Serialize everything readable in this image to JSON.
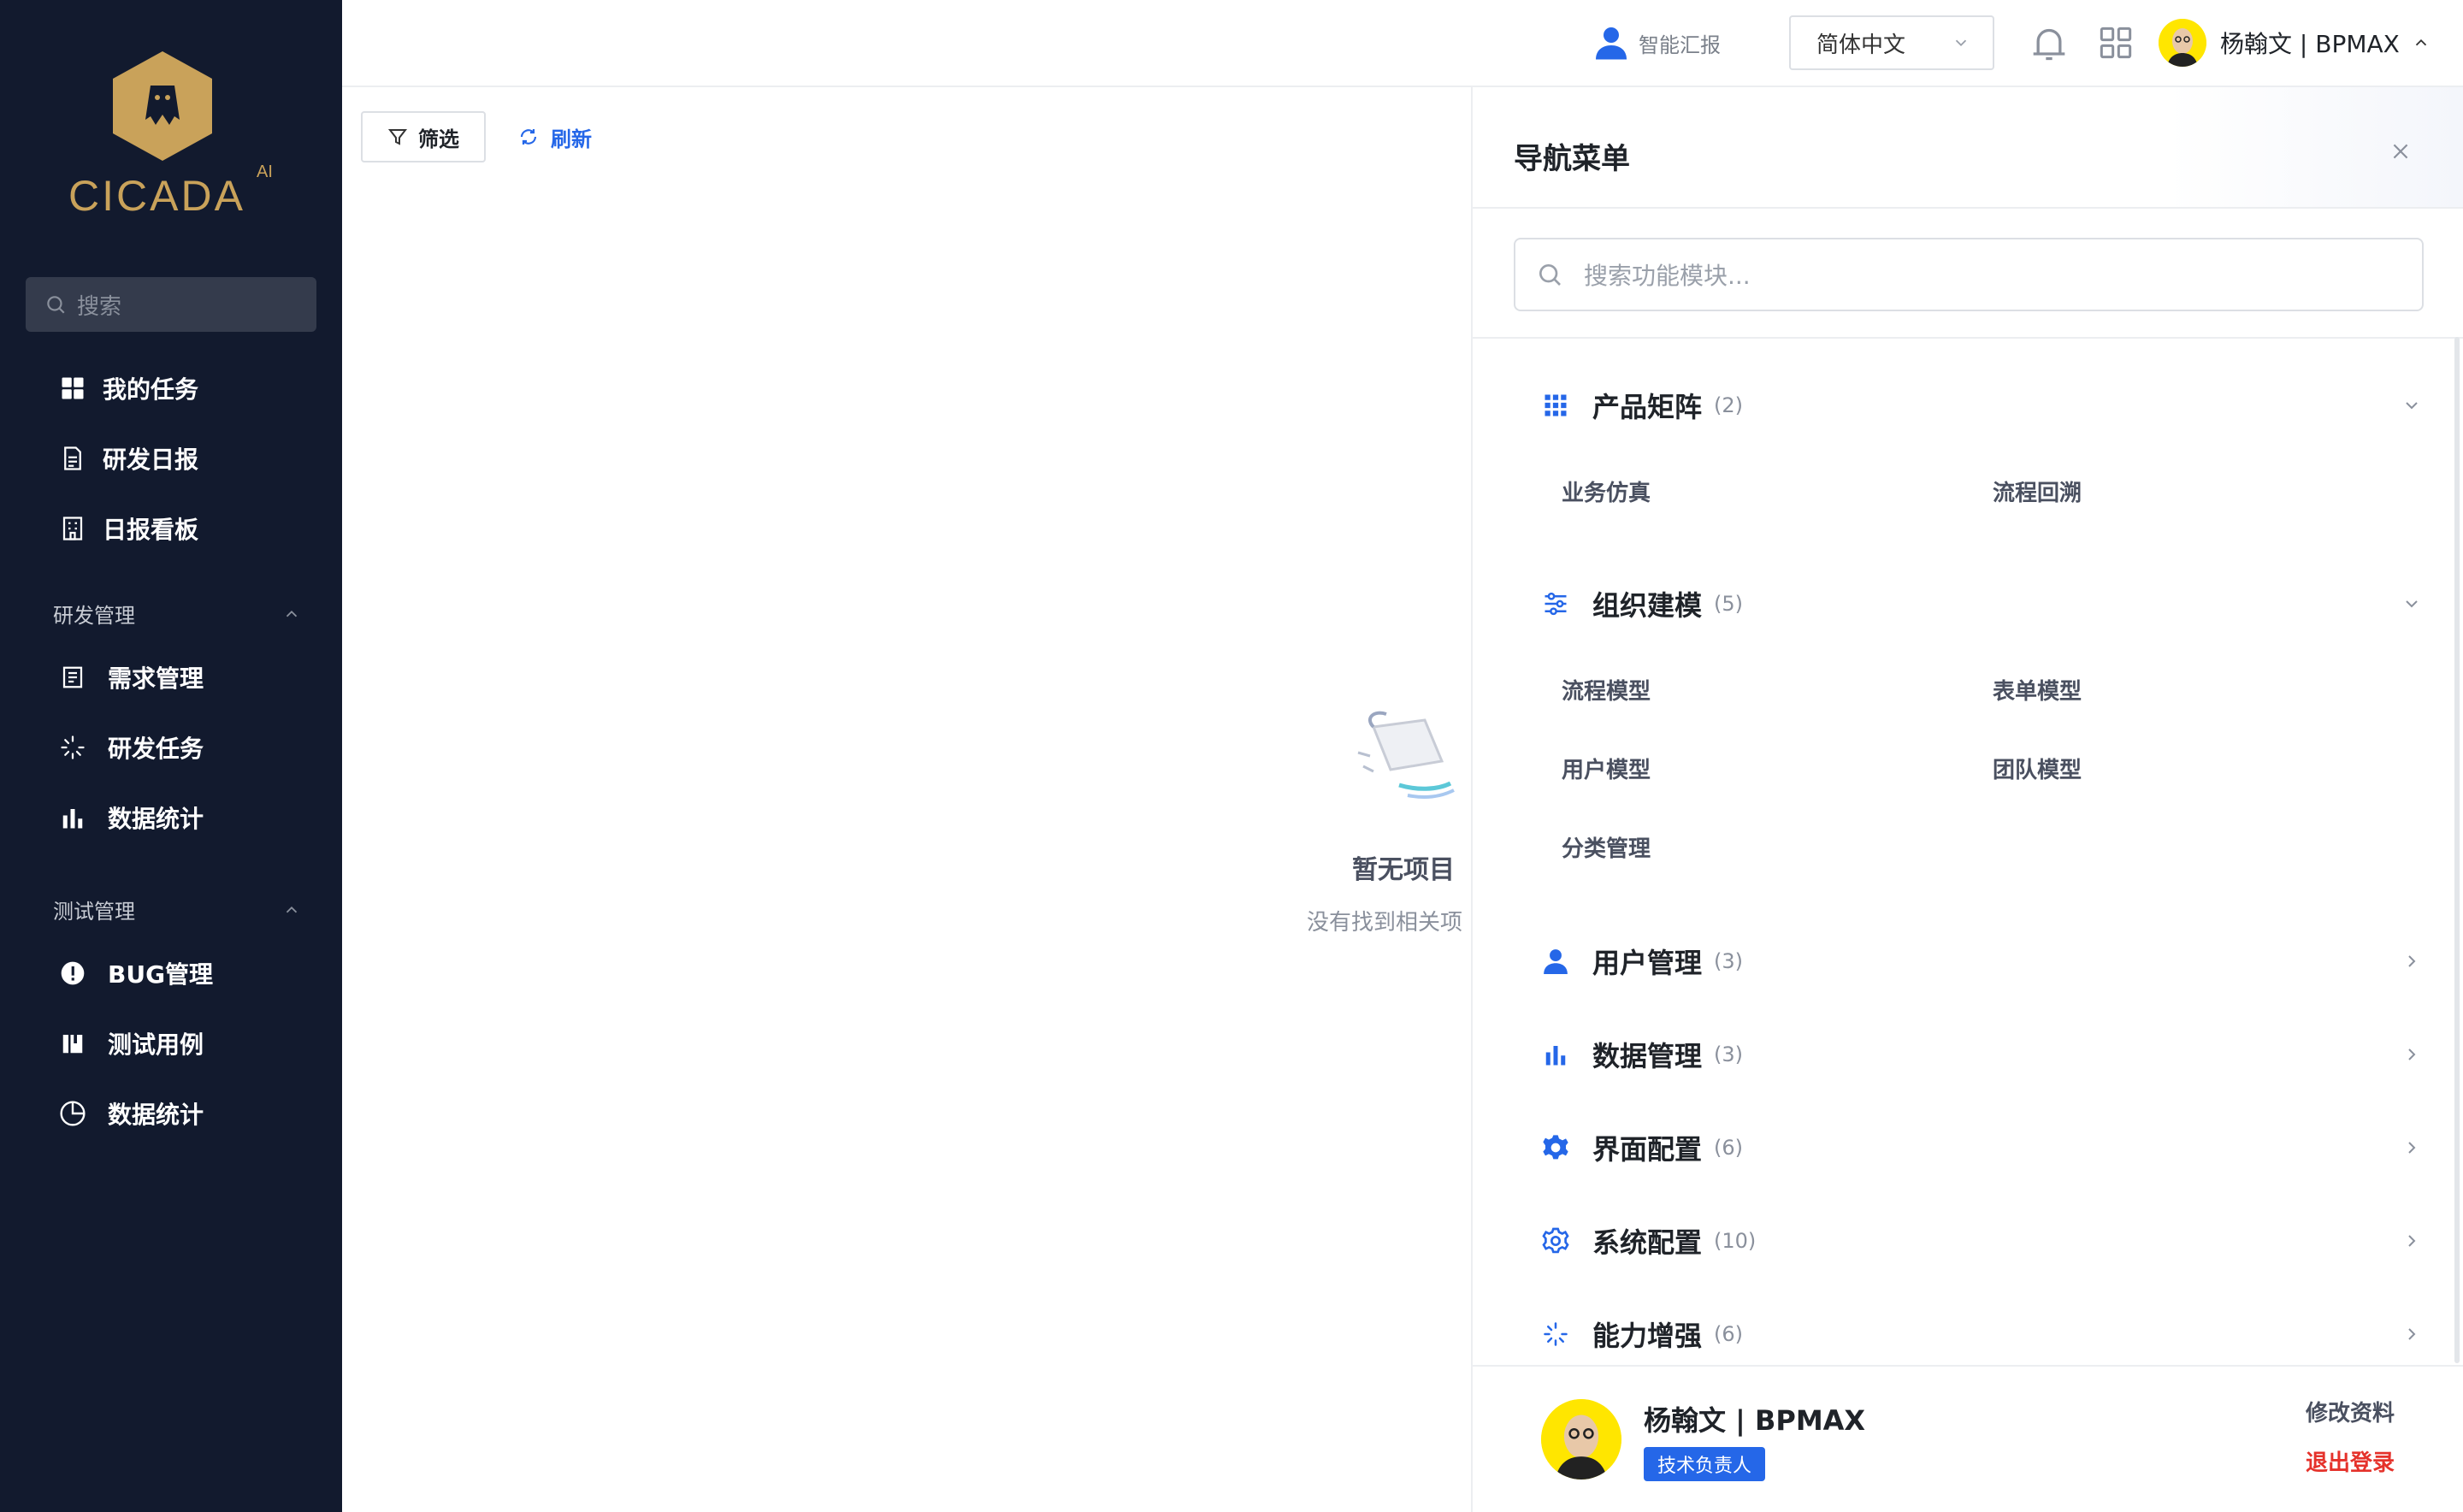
{
  "app": {
    "brand": "CICADA",
    "brand_suffix": "AI",
    "brand_color": "#c9a25a"
  },
  "sidebar": {
    "search_placeholder": "搜索",
    "top_items": [
      {
        "label": "我的任务",
        "icon": "dashboard-icon"
      },
      {
        "label": "研发日报",
        "icon": "document-icon"
      },
      {
        "label": "日报看板",
        "icon": "building-icon"
      }
    ],
    "groups": [
      {
        "title": "研发管理",
        "items": [
          {
            "label": "需求管理",
            "icon": "list-document-icon"
          },
          {
            "label": "研发任务",
            "icon": "loading-spark-icon"
          },
          {
            "label": "数据统计",
            "icon": "bar-chart-icon"
          }
        ]
      },
      {
        "title": "测试管理",
        "items": [
          {
            "label": "BUG管理",
            "icon": "alert-circle-icon"
          },
          {
            "label": "测试用例",
            "icon": "book-icon"
          },
          {
            "label": "数据统计",
            "icon": "pie-chart-icon"
          }
        ]
      }
    ]
  },
  "topbar": {
    "report_label": "智能汇报",
    "language": "简体中文",
    "user_name": "杨翰文 | BPMAX"
  },
  "toolbar": {
    "filter_label": "筛选",
    "refresh_label": "刷新"
  },
  "empty_state": {
    "title": "暂无项目",
    "description": "没有找到相关项"
  },
  "drawer": {
    "title": "导航菜单",
    "search_placeholder": "搜索功能模块...",
    "categories": [
      {
        "name": "产品矩阵",
        "count": "(2)",
        "icon": "apps-grid-icon",
        "expanded": true,
        "modules": [
          "业务仿真",
          "流程回溯"
        ]
      },
      {
        "name": "组织建模",
        "count": "(5)",
        "icon": "sliders-icon",
        "expanded": true,
        "modules": [
          "流程模型",
          "表单模型",
          "用户模型",
          "团队模型",
          "分类管理"
        ]
      },
      {
        "name": "用户管理",
        "count": "(3)",
        "icon": "user-icon",
        "expanded": false
      },
      {
        "name": "数据管理",
        "count": "(3)",
        "icon": "bar-chart-icon",
        "expanded": false
      },
      {
        "name": "界面配置",
        "count": "(6)",
        "icon": "gear-filled-icon",
        "expanded": false
      },
      {
        "name": "系统配置",
        "count": "(10)",
        "icon": "gear-outline-icon",
        "expanded": false
      },
      {
        "name": "能力增强",
        "count": "(6)",
        "icon": "loading-spark-icon",
        "expanded": false
      }
    ],
    "footer": {
      "user_name": "杨翰文 | BPMAX",
      "role": "技术负责人",
      "edit_label": "修改资料",
      "logout_label": "退出登录"
    }
  },
  "colors": {
    "sidebar_bg": "#121a2e",
    "accent": "#2567e8",
    "danger": "#e5322b"
  }
}
